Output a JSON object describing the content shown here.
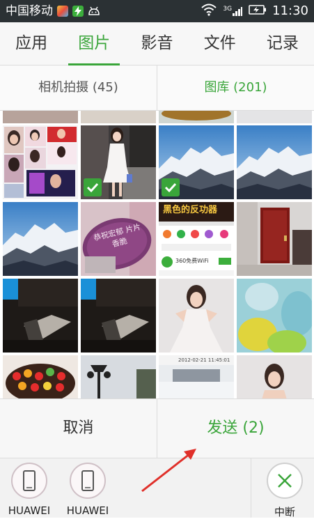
{
  "status_bar": {
    "carrier": "中国移动",
    "network": "3G",
    "time": "11:30"
  },
  "tabs": [
    {
      "label": "应用",
      "active": false
    },
    {
      "label": "图片",
      "active": true
    },
    {
      "label": "影音",
      "active": false
    },
    {
      "label": "文件",
      "active": false
    },
    {
      "label": "记录",
      "active": false
    }
  ],
  "sub_tabs": [
    {
      "label": "相机拍摄 (45)",
      "active": false
    },
    {
      "label": "图库 (201)",
      "active": true
    }
  ],
  "photos": [
    {
      "subject": "portrait-collage",
      "selected": false
    },
    {
      "subject": "woman-white-dress",
      "selected": true
    },
    {
      "subject": "snow-mountain",
      "selected": true
    },
    {
      "subject": "snow-mountain",
      "selected": false
    },
    {
      "subject": "snow-mountain",
      "selected": false
    },
    {
      "subject": "pink-gift-tag",
      "selected": false
    },
    {
      "subject": "app-screenshot",
      "selected": false
    },
    {
      "subject": "red-door-room",
      "selected": false
    },
    {
      "subject": "monitor-phone",
      "selected": false
    },
    {
      "subject": "monitor-phone",
      "selected": false
    },
    {
      "subject": "woman-white-gown",
      "selected": false
    },
    {
      "subject": "easter-eggs",
      "selected": false
    },
    {
      "subject": "fruit-cake",
      "selected": false
    },
    {
      "subject": "street-lamp",
      "selected": false
    },
    {
      "subject": "snow-road",
      "selected": false
    },
    {
      "subject": "woman-portrait",
      "selected": false
    }
  ],
  "photo_texts": {
    "pink_tag": "恭祝宏郁 片片香脆",
    "app_banner": "黑色的反功器",
    "wifi_label": "360免费WiFi",
    "snow_road_timestamp": "2012-02-21 11:45:01"
  },
  "actions": {
    "cancel": "取消",
    "send": "发送 (2)"
  },
  "share_targets": [
    {
      "label": "HUAWEI",
      "icon": "phone-icon"
    },
    {
      "label": "HUAWEI",
      "icon": "phone-icon"
    }
  ],
  "stop_label": "中断",
  "colors": {
    "accent": "#3aa53a",
    "status_bar": "#2b3134",
    "annotation_arrow": "#e0302a"
  }
}
